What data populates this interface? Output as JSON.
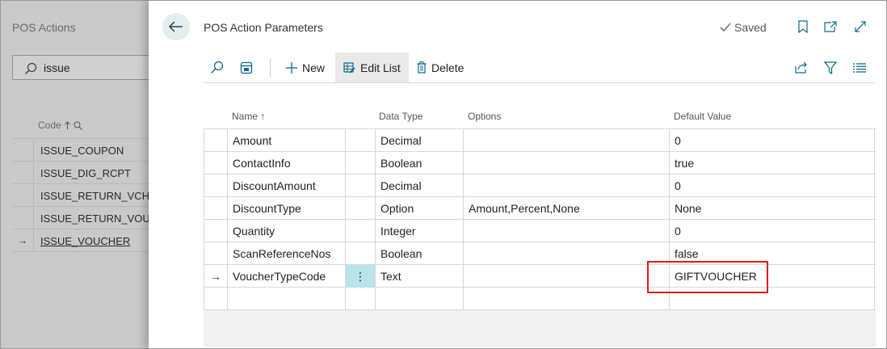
{
  "background": {
    "title": "POS Actions",
    "search_value": "issue",
    "column_header": "Code",
    "rows": [
      {
        "code": "ISSUE_COUPON",
        "selected": ""
      },
      {
        "code": "ISSUE_DIG_RCPT",
        "selected": ""
      },
      {
        "code": "ISSUE_RETURN_VCHR_",
        "selected": ""
      },
      {
        "code": "ISSUE_RETURN_VOUC",
        "selected": ""
      },
      {
        "code": "ISSUE_VOUCHER",
        "selected": "→"
      }
    ]
  },
  "dialog": {
    "title": "POS Action Parameters",
    "saved_label": "Saved",
    "toolbar": {
      "new_label": "New",
      "edit_list_label": "Edit List",
      "delete_label": "Delete"
    },
    "columns": {
      "name": "Name",
      "data_type": "Data Type",
      "options": "Options",
      "default_value": "Default Value"
    },
    "rows": [
      {
        "sel": "",
        "name": "Amount",
        "type": "Decimal",
        "options": "",
        "default": "0"
      },
      {
        "sel": "",
        "name": "ContactInfo",
        "type": "Boolean",
        "options": "",
        "default": "true"
      },
      {
        "sel": "",
        "name": "DiscountAmount",
        "type": "Decimal",
        "options": "",
        "default": "0"
      },
      {
        "sel": "",
        "name": "DiscountType",
        "type": "Option",
        "options": "Amount,Percent,None",
        "default": "None"
      },
      {
        "sel": "",
        "name": "Quantity",
        "type": "Integer",
        "options": "",
        "default": "0"
      },
      {
        "sel": "",
        "name": "ScanReferenceNos",
        "type": "Boolean",
        "options": "",
        "default": "false"
      },
      {
        "sel": "→",
        "name": "VoucherTypeCode",
        "type": "Text",
        "options": "",
        "default": "GIFTVOUCHER"
      },
      {
        "sel": "",
        "name": "",
        "type": "",
        "options": "",
        "default": ""
      }
    ],
    "dots_glyph": "⋮"
  },
  "colors": {
    "accent": "#b8e4ec",
    "highlight": "#e01b1b"
  }
}
